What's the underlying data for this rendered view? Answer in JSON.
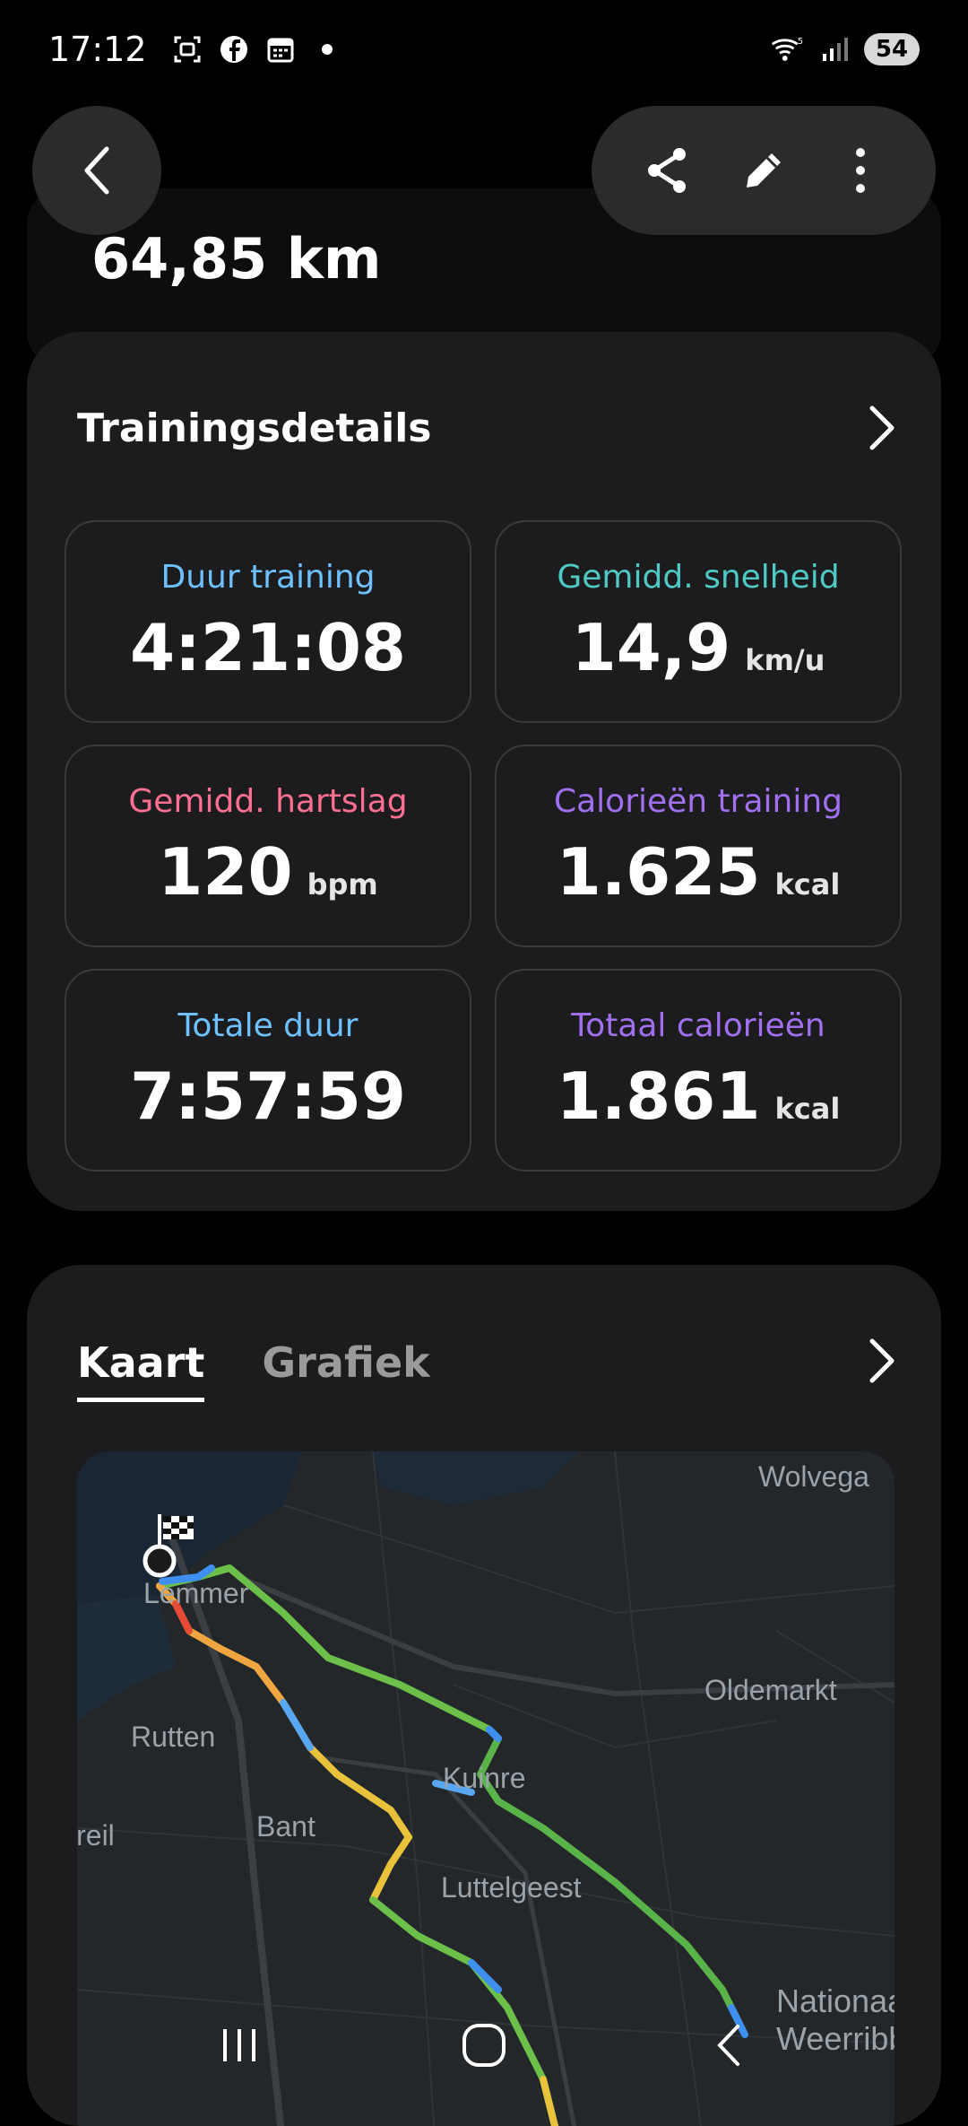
{
  "status_bar": {
    "time": "17:12",
    "battery": "54"
  },
  "header": {
    "distance": "64,85 km"
  },
  "details": {
    "title": "Trainingsdetails",
    "stats": [
      {
        "label": "Duur training",
        "value": "4:21:08",
        "unit": "",
        "color": "#6ec1ff"
      },
      {
        "label": "Gemidd. snelheid",
        "value": "14,9",
        "unit": "km/u",
        "color": "#4fc9c4"
      },
      {
        "label": "Gemidd. hartslag",
        "value": "120",
        "unit": "bpm",
        "color": "#ff6f92"
      },
      {
        "label": "Calorieën training",
        "value": "1.625",
        "unit": "kcal",
        "color": "#a070f0"
      },
      {
        "label": "Totale duur",
        "value": "7:57:59",
        "unit": "",
        "color": "#6ec1ff"
      },
      {
        "label": "Totaal calorieën",
        "value": "1.861",
        "unit": "kcal",
        "color": "#a070f0"
      }
    ]
  },
  "map_section": {
    "tabs": [
      "Kaart",
      "Grafiek"
    ],
    "active_tab": "Kaart",
    "places": [
      "Wolvega",
      "Lemmer",
      "Oldemarkt",
      "Rutten",
      "Kuinre",
      "Creil",
      "Bant",
      "Luttelgeest",
      "Nationaal Weerribben"
    ]
  },
  "icons": {
    "back": "back-arrow-icon",
    "share": "share-icon",
    "edit": "pencil-icon",
    "more": "more-vertical-icon"
  }
}
